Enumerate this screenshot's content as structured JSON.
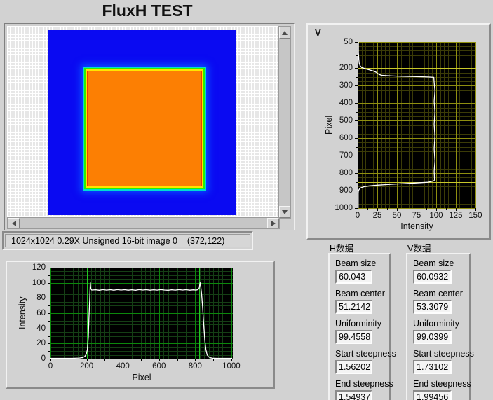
{
  "title": "FluxH TEST",
  "image_viewer": {
    "status_text": "1024x1024 0.29X Unsigned 16-bit image 0    (372,122)",
    "colors": {
      "background_blue": "#0a0af2",
      "beam_orange": "#fc7f03",
      "edge_green": "#2bee00",
      "edge_yellow": "#ffe400",
      "edge_cyan": "#00dcd2"
    }
  },
  "charts": {
    "h": {
      "type": "line",
      "xlabel": "Pixel",
      "ylabel": "Intensity",
      "xlim": [
        0,
        1008
      ],
      "ylim": [
        0,
        120
      ],
      "x_ticks": [
        0,
        200,
        400,
        600,
        800,
        1000
      ],
      "y_ticks": [
        0,
        20,
        40,
        60,
        80,
        100,
        120
      ],
      "x_minor": 25,
      "y_minor": 5,
      "y_down": false,
      "grid_minor": "#153f15",
      "grid_major": "#0c870c",
      "cursor_color": "#21c821",
      "cursors_x": [
        202,
        823
      ],
      "cursors_y": [],
      "curve_color": "#ffffff",
      "points": [
        [
          0,
          0.5
        ],
        [
          120,
          0.5
        ],
        [
          160,
          0.8
        ],
        [
          178,
          1.5
        ],
        [
          190,
          3
        ],
        [
          198,
          6
        ],
        [
          204,
          12
        ],
        [
          209,
          28
        ],
        [
          213,
          55
        ],
        [
          217,
          80
        ],
        [
          220,
          101
        ],
        [
          223,
          92
        ],
        [
          228,
          90.5
        ],
        [
          250,
          90.8
        ],
        [
          270,
          90.2
        ],
        [
          290,
          91
        ],
        [
          310,
          90.4
        ],
        [
          330,
          90.9
        ],
        [
          350,
          90.3
        ],
        [
          370,
          91
        ],
        [
          390,
          90.5
        ],
        [
          410,
          90.9
        ],
        [
          430,
          90.3
        ],
        [
          450,
          90.8
        ],
        [
          470,
          90.2
        ],
        [
          490,
          91
        ],
        [
          510,
          90.5
        ],
        [
          530,
          90.9
        ],
        [
          550,
          90.3
        ],
        [
          570,
          90.8
        ],
        [
          590,
          90.4
        ],
        [
          610,
          91
        ],
        [
          630,
          90.5
        ],
        [
          650,
          90.2
        ],
        [
          670,
          90.8
        ],
        [
          690,
          90.4
        ],
        [
          710,
          91
        ],
        [
          730,
          90.5
        ],
        [
          750,
          90.9
        ],
        [
          770,
          90.3
        ],
        [
          790,
          90.7
        ],
        [
          805,
          90.4
        ],
        [
          815,
          91
        ],
        [
          822,
          93
        ],
        [
          827,
          100
        ],
        [
          830,
          96
        ],
        [
          835,
          86
        ],
        [
          841,
          68
        ],
        [
          847,
          45
        ],
        [
          853,
          25
        ],
        [
          859,
          12
        ],
        [
          866,
          5
        ],
        [
          874,
          2.5
        ],
        [
          883,
          1.2
        ],
        [
          895,
          0.6
        ],
        [
          920,
          0.5
        ],
        [
          1005,
          0.5
        ]
      ]
    },
    "v": {
      "type": "line",
      "panel_label": "V",
      "xlabel": "Intensity",
      "ylabel": "Pixel",
      "xlim": [
        0,
        151
      ],
      "ylim": [
        50,
        1000
      ],
      "x_ticks": [
        0,
        25,
        50,
        75,
        100,
        125,
        150
      ],
      "y_ticks": [
        50,
        200,
        300,
        400,
        500,
        600,
        700,
        800,
        900,
        1000
      ],
      "x_minor": 5,
      "y_minor": 25,
      "y_down": true,
      "grid_minor": "#3b3b07",
      "grid_major": "#8f8f10",
      "cursor_color": "#c8c82a",
      "cursors_x": [],
      "cursors_y": [
        200,
        851
      ],
      "curve_color": "#ffffff",
      "points": [
        [
          1,
          50
        ],
        [
          1,
          110
        ],
        [
          1.5,
          150
        ],
        [
          2,
          170
        ],
        [
          3,
          185
        ],
        [
          5,
          195
        ],
        [
          8,
          200
        ],
        [
          10,
          203
        ],
        [
          15,
          209
        ],
        [
          20,
          216
        ],
        [
          24,
          224
        ],
        [
          26,
          232
        ],
        [
          30,
          240
        ],
        [
          40,
          243
        ],
        [
          55,
          246
        ],
        [
          75,
          248
        ],
        [
          90,
          250
        ],
        [
          97,
          252
        ],
        [
          97.5,
          280
        ],
        [
          98.5,
          330
        ],
        [
          97.5,
          390
        ],
        [
          98.5,
          450
        ],
        [
          97.5,
          520
        ],
        [
          98.5,
          590
        ],
        [
          97.5,
          660
        ],
        [
          98.5,
          730
        ],
        [
          97.5,
          790
        ],
        [
          98,
          838
        ],
        [
          97,
          845
        ],
        [
          90,
          852
        ],
        [
          80,
          855
        ],
        [
          65,
          859
        ],
        [
          50,
          862
        ],
        [
          35,
          866
        ],
        [
          25,
          869
        ],
        [
          15,
          873
        ],
        [
          9,
          877
        ],
        [
          5,
          882
        ],
        [
          3,
          887
        ],
        [
          2,
          893
        ],
        [
          1,
          900
        ],
        [
          0.7,
          915
        ],
        [
          0.7,
          1000
        ]
      ]
    }
  },
  "data_panels": [
    {
      "title": "H数据",
      "fields": [
        {
          "label": "Beam size",
          "value": "60.043"
        },
        {
          "label": "Beam center",
          "value": "51.2142"
        },
        {
          "label": "Uniforminity",
          "value": "99.4558"
        },
        {
          "label": "Start steepness",
          "value": "1.56202"
        },
        {
          "label": "End steepness",
          "value": "1.54937"
        }
      ]
    },
    {
      "title": "V数据",
      "fields": [
        {
          "label": "Beam size",
          "value": "60.0932"
        },
        {
          "label": "Beam center",
          "value": "53.3079"
        },
        {
          "label": "Uniforminity",
          "value": "99.0399"
        },
        {
          "label": "Start steepness",
          "value": "1.73102"
        },
        {
          "label": "End steepness",
          "value": "1.99456"
        }
      ]
    }
  ]
}
